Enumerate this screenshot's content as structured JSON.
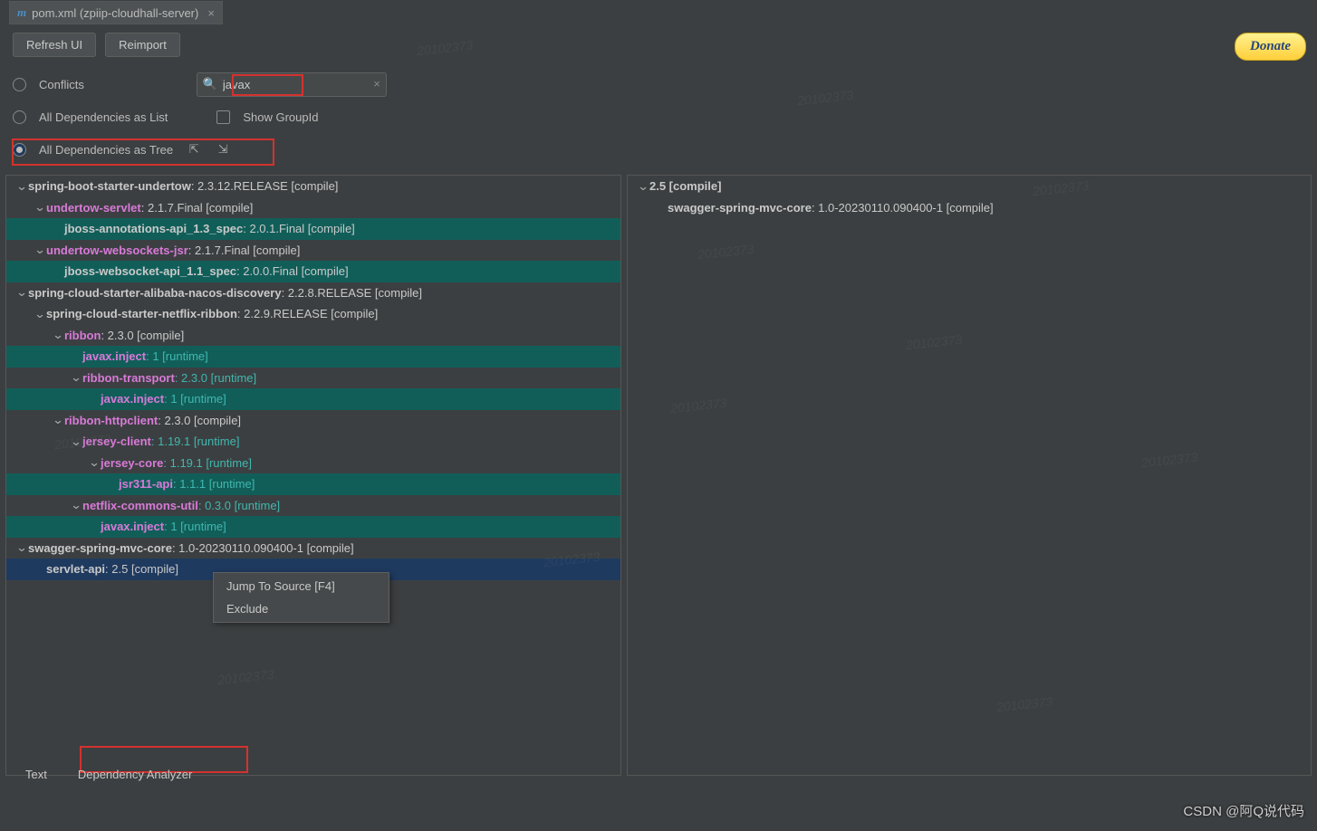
{
  "tab": {
    "icon": "m",
    "title": "pom.xml (zpiip-cloudhall-server)"
  },
  "toolbar": {
    "refresh": "Refresh UI",
    "reimport": "Reimport",
    "donate": "Donate"
  },
  "filters": {
    "conflicts": "Conflicts",
    "list": "All Dependencies as List",
    "tree": "All Dependencies as Tree",
    "show_group": "Show GroupId",
    "search_value": "javax",
    "selected": "tree"
  },
  "left_tree": [
    {
      "d": 0,
      "exp": true,
      "hl": false,
      "name": "spring-boot-starter-undertow",
      "ver": ": 2.3.12.RELEASE [compile]"
    },
    {
      "d": 1,
      "exp": true,
      "hl": false,
      "name": "undertow-servlet",
      "ver": ": 2.1.7.Final [compile]",
      "pink": true
    },
    {
      "d": 2,
      "exp": null,
      "hl": true,
      "name": "jboss-annotations-api_1.3_spec",
      "ver": ": 2.0.1.Final [compile]"
    },
    {
      "d": 1,
      "exp": true,
      "hl": false,
      "name": "undertow-websockets-jsr",
      "ver": ": 2.1.7.Final [compile]",
      "pink": true
    },
    {
      "d": 2,
      "exp": null,
      "hl": true,
      "name": "jboss-websocket-api_1.1_spec",
      "ver": ": 2.0.0.Final [compile]"
    },
    {
      "d": 0,
      "exp": true,
      "hl": false,
      "name": "spring-cloud-starter-alibaba-nacos-discovery",
      "ver": ": 2.2.8.RELEASE [compile]"
    },
    {
      "d": 1,
      "exp": true,
      "hl": false,
      "name": "spring-cloud-starter-netflix-ribbon",
      "ver": ": 2.2.9.RELEASE [compile]"
    },
    {
      "d": 2,
      "exp": true,
      "hl": false,
      "name": "ribbon",
      "ver": ": 2.3.0 [compile]",
      "pink": true
    },
    {
      "d": 3,
      "exp": null,
      "hl": true,
      "name": "javax.inject",
      "ver": ": 1 [runtime]",
      "pink": true,
      "tealver": true
    },
    {
      "d": 3,
      "exp": true,
      "hl": false,
      "name": "ribbon-transport",
      "ver": ": 2.3.0 [runtime]",
      "pink": true,
      "tealver": true
    },
    {
      "d": 4,
      "exp": null,
      "hl": true,
      "name": "javax.inject",
      "ver": ": 1 [runtime]",
      "pink": true,
      "tealver": true
    },
    {
      "d": 2,
      "exp": true,
      "hl": false,
      "name": "ribbon-httpclient",
      "ver": ": 2.3.0 [compile]",
      "pink": true
    },
    {
      "d": 3,
      "exp": true,
      "hl": false,
      "name": "jersey-client",
      "ver": ": 1.19.1 [runtime]",
      "pink": true,
      "tealver": true
    },
    {
      "d": 4,
      "exp": true,
      "hl": false,
      "name": "jersey-core",
      "ver": ": 1.19.1 [runtime]",
      "pink": true,
      "tealver": true
    },
    {
      "d": 5,
      "exp": null,
      "hl": true,
      "name": "jsr311-api",
      "ver": ": 1.1.1 [runtime]",
      "pink": true,
      "tealver": true
    },
    {
      "d": 3,
      "exp": true,
      "hl": false,
      "name": "netflix-commons-util",
      "ver": ": 0.3.0 [runtime]",
      "pink": true,
      "tealver": true
    },
    {
      "d": 4,
      "exp": null,
      "hl": true,
      "name": "javax.inject",
      "ver": ": 1 [runtime]",
      "pink": true,
      "tealver": true
    },
    {
      "d": 0,
      "exp": true,
      "hl": false,
      "name": "swagger-spring-mvc-core",
      "ver": ": 1.0-20230110.090400-1 [compile]"
    },
    {
      "d": 1,
      "exp": null,
      "hl": false,
      "sel": true,
      "name": "servlet-api",
      "ver": ": 2.5 [compile]"
    }
  ],
  "right_tree": [
    {
      "d": 0,
      "exp": true,
      "name": "2.5 [compile]"
    },
    {
      "d": 1,
      "exp": null,
      "name": "swagger-spring-mvc-core",
      "ver": ": 1.0-20230110.090400-1 [compile]"
    }
  ],
  "context_menu": {
    "jump": "Jump To Source [F4]",
    "exclude": "Exclude"
  },
  "bottom_tabs": {
    "text": "Text",
    "analyzer": "Dependency Analyzer"
  },
  "attribution": "CSDN @阿Q说代码",
  "watermark_text": "20102373"
}
